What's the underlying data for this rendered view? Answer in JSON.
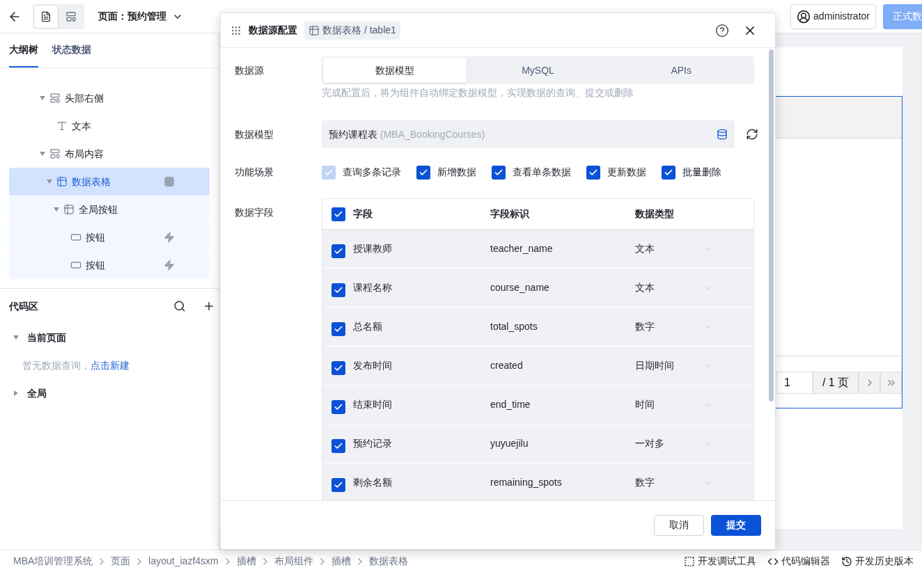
{
  "topbar": {
    "page_title": "页面：预约管理",
    "user": "administrator",
    "publish_button": "正式数"
  },
  "sidebar": {
    "tabs": [
      {
        "label": "大纲树",
        "selected": true
      },
      {
        "label": "状态数据",
        "selected": false
      }
    ],
    "tree": [
      {
        "label": "头部右侧",
        "kind": "layout",
        "expanded": true,
        "selected": false,
        "children": [
          {
            "label": "文本",
            "kind": "text",
            "selected": false
          }
        ]
      },
      {
        "label": "布局内容",
        "kind": "layout",
        "expanded": true,
        "selected": false,
        "children": [
          {
            "label": "数据表格",
            "kind": "table",
            "data_bound": true,
            "expanded": true,
            "selected": true,
            "children": [
              {
                "label": "全局按钮",
                "kind": "table",
                "expanded": true,
                "selected": false,
                "children": [
                  {
                    "label": "按钮",
                    "kind": "button",
                    "has_events": true,
                    "selected": false
                  },
                  {
                    "label": "按钮",
                    "kind": "button",
                    "has_events": true,
                    "selected": false
                  }
                ]
              }
            ]
          }
        ]
      }
    ]
  },
  "code_area": {
    "title": "代码区",
    "sections": [
      {
        "label": "当前页面",
        "expanded": true,
        "empty_text": "暂无数据查询，",
        "link": "点击新建"
      },
      {
        "label": "全局",
        "expanded": false
      }
    ]
  },
  "canvas": {
    "pagination": {
      "page": "1",
      "total": "/ 1 页"
    }
  },
  "dialog": {
    "title": "数据源配置",
    "tag": "数据表格 / table1",
    "source": {
      "label": "数据源",
      "tabs": [
        {
          "label": "数据模型",
          "selected": true
        },
        {
          "label": "MySQL",
          "selected": false
        },
        {
          "label": "APIs",
          "selected": false
        }
      ],
      "hint": "完成配置后，将为组件自动绑定数据模型，实现数据的查询、提交或删除"
    },
    "model": {
      "label": "数据模型",
      "name": "预约课程表",
      "id": "(MBA_BookingCourses)"
    },
    "scenarios": {
      "label": "功能场景",
      "items": [
        {
          "label": "查询多条记录",
          "checked": true,
          "disabled": true
        },
        {
          "label": "新增数据",
          "checked": true,
          "disabled": false
        },
        {
          "label": "查看单条数据",
          "checked": true,
          "disabled": false
        },
        {
          "label": "更新数据",
          "checked": true,
          "disabled": false
        },
        {
          "label": "批量删除",
          "checked": true,
          "disabled": false
        }
      ]
    },
    "fields": {
      "label": "数据字段",
      "columns": [
        "字段",
        "字段标识",
        "数据类型"
      ],
      "all_checked": true,
      "rows": [
        {
          "name": "授课教师",
          "key": "teacher_name",
          "type": "文本",
          "checked": true
        },
        {
          "name": "课程名称",
          "key": "course_name",
          "type": "文本",
          "checked": true
        },
        {
          "name": "总名额",
          "key": "total_spots",
          "type": "数字",
          "checked": true
        },
        {
          "name": "发布时间",
          "key": "created",
          "type": "日期时间",
          "checked": true
        },
        {
          "name": "结束时间",
          "key": "end_time",
          "type": "时间",
          "checked": true
        },
        {
          "name": "预约记录",
          "key": "yuyuejilu",
          "type": "一对多",
          "checked": true
        },
        {
          "name": "剩余名额",
          "key": "remaining_spots",
          "type": "数字",
          "checked": true
        }
      ]
    },
    "buttons": {
      "cancel": "取消",
      "submit": "提交"
    }
  },
  "breadcrumb": [
    "MBA培训管理系统",
    "页面",
    "layout_iazf4sxm",
    "插槽",
    "布局组件",
    "插槽",
    "数据表格"
  ],
  "tools": [
    "开发调试工具",
    "代码编辑器",
    "开发历史版本"
  ]
}
